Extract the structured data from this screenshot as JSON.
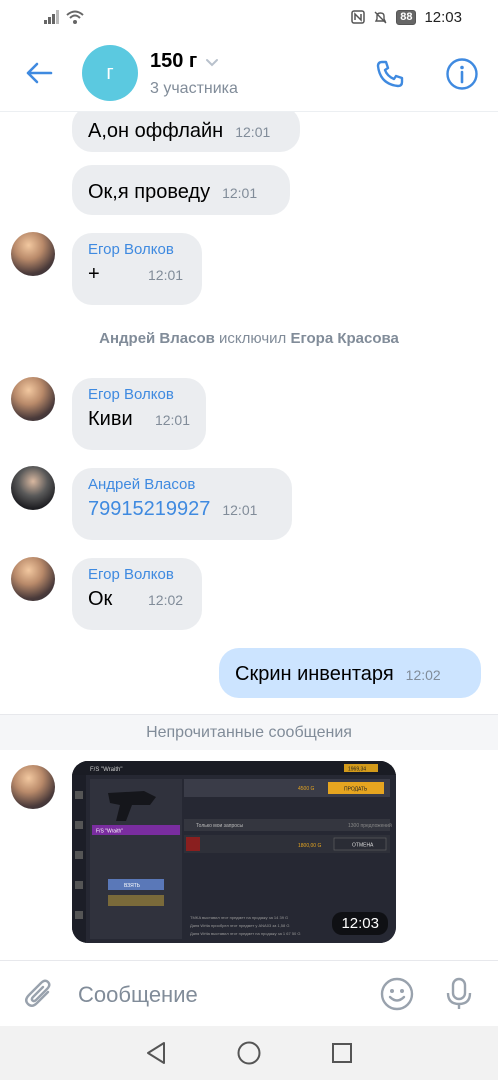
{
  "status_bar": {
    "time": "12:03",
    "battery": "88"
  },
  "header": {
    "avatar_letter": "г",
    "title": "150 г",
    "subtitle": "3 участника"
  },
  "messages": [
    {
      "text": "А,он оффлайн",
      "time": "12:01"
    },
    {
      "text": "Ок,я проведу",
      "time": "12:01"
    },
    {
      "author": "Егор Волков",
      "text": "+",
      "time": "12:01"
    },
    {
      "author": "Егор Волков",
      "text": "Киви",
      "time": "12:01"
    },
    {
      "author": "Андрей Власов",
      "text": "79915219927",
      "time": "12:01"
    },
    {
      "author": "Егор Волков",
      "text": "Ок",
      "time": "12:02"
    },
    {
      "text": "Скрин инвентаря",
      "time": "12:02"
    }
  ],
  "system": {
    "actor": "Андрей Власов",
    "action": "исключил",
    "target": "Егора Красова"
  },
  "unread_label": "Непрочитанные сообщения",
  "photo": {
    "time": "12:03",
    "weapon_title": "F/S \"Wraith\"",
    "slot_label": "F/S \"Wraith\"",
    "price_tag": "1969,34",
    "sell_action": "ПРОДАТЬ",
    "cancel_action": "ОТМЕНА",
    "equip_action": "ВЗЯТЬ",
    "list_label": "Только мои запросы",
    "count_label": "1300 предложений",
    "price_value": "4500 G",
    "row_price": "1800,00 G",
    "log_lines": [
      "TMKA выставил этот предмет на продажу за 14 39 G",
      "Даня Wrtta приобрел этот предмет у ANA03 за 1,58 G",
      "Даня Wrtta выставил этот предмет на продажу за 1 67 50 G"
    ]
  },
  "input": {
    "placeholder": "Сообщение"
  },
  "colors": {
    "accent": "#3f8ae0",
    "bubble_in": "#ebedf0",
    "bubble_out": "#cce4ff",
    "secondary_text": "#818c99",
    "chat_avatar": "#5bc9e0"
  }
}
